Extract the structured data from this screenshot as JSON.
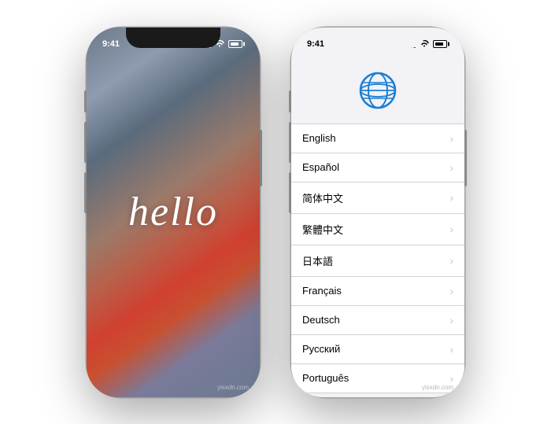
{
  "phone1": {
    "label": "iPhone hello screen",
    "hello_text": "hello",
    "status": {
      "time": "9:41",
      "signal_bars": [
        3,
        5,
        7,
        9,
        11
      ],
      "battery_pct": 65
    }
  },
  "phone2": {
    "label": "iPhone language selection screen",
    "status": {
      "time": "9:41",
      "signal_bars": [
        3,
        5,
        7,
        9,
        11
      ],
      "battery_pct": 65
    },
    "globe_label": "globe",
    "languages": [
      {
        "name": "English",
        "id": "en"
      },
      {
        "name": "Español",
        "id": "es"
      },
      {
        "name": "简体中文",
        "id": "zh-hans"
      },
      {
        "name": "繁體中文",
        "id": "zh-hant"
      },
      {
        "name": "日本語",
        "id": "ja"
      },
      {
        "name": "Français",
        "id": "fr"
      },
      {
        "name": "Deutsch",
        "id": "de"
      },
      {
        "name": "Русский",
        "id": "ru"
      },
      {
        "name": "Português",
        "id": "pt"
      }
    ]
  },
  "watermark": "yisxdn.com",
  "accent_color": "#1a7fd4",
  "colors": {
    "hello_bg_start": "#6b7a8a",
    "hello_bg_end": "#d04030",
    "list_bg": "#f2f2f7",
    "list_item_bg": "#ffffff",
    "list_border": "#d1d1d6"
  }
}
